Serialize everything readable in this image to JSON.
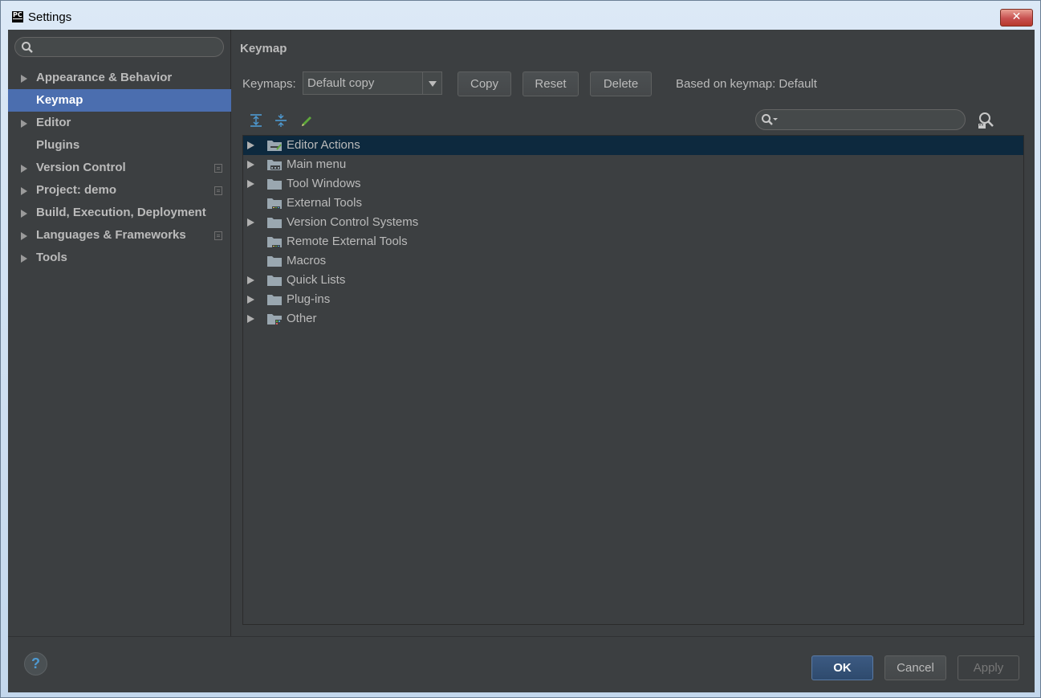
{
  "window": {
    "title": "Settings",
    "close_glyph": "✕"
  },
  "sidebar": {
    "search_placeholder": "",
    "items": [
      {
        "label": "Appearance & Behavior",
        "expandable": true
      },
      {
        "label": "Keymap",
        "expandable": false,
        "selected": true
      },
      {
        "label": "Editor",
        "expandable": true
      },
      {
        "label": "Plugins",
        "expandable": false
      },
      {
        "label": "Version Control",
        "expandable": true,
        "project_icon": true
      },
      {
        "label": "Project: demo",
        "expandable": true,
        "project_icon": true
      },
      {
        "label": "Build, Execution, Deployment",
        "expandable": true
      },
      {
        "label": "Languages & Frameworks",
        "expandable": true,
        "project_icon": true
      },
      {
        "label": "Tools",
        "expandable": true
      }
    ]
  },
  "main": {
    "title": "Keymap",
    "keymaps_label": "Keymaps:",
    "keymap_selected": "Default copy",
    "buttons": {
      "copy": "Copy",
      "reset": "Reset",
      "delete": "Delete"
    },
    "based_on": "Based on keymap: Default",
    "tree_search_placeholder": "",
    "tree": [
      {
        "label": "Editor Actions",
        "expandable": true,
        "selected": true,
        "icon": "editor-actions-folder-icon"
      },
      {
        "label": "Main menu",
        "expandable": true,
        "icon": "menu-folder-icon"
      },
      {
        "label": "Tool Windows",
        "expandable": true,
        "icon": "folder-icon"
      },
      {
        "label": "External Tools",
        "expandable": false,
        "icon": "tools-folder-icon"
      },
      {
        "label": "Version Control Systems",
        "expandable": true,
        "icon": "folder-icon"
      },
      {
        "label": "Remote External Tools",
        "expandable": false,
        "icon": "tools-folder-icon"
      },
      {
        "label": "Macros",
        "expandable": false,
        "icon": "folder-icon"
      },
      {
        "label": "Quick Lists",
        "expandable": true,
        "icon": "folder-icon"
      },
      {
        "label": "Plug-ins",
        "expandable": true,
        "icon": "folder-icon"
      },
      {
        "label": "Other",
        "expandable": true,
        "icon": "other-folder-icon"
      }
    ]
  },
  "footer": {
    "help": "?",
    "ok": "OK",
    "cancel": "Cancel",
    "apply": "Apply"
  },
  "colors": {
    "background": "#3c3f41",
    "selection": "#4b6eaf",
    "tree_selection": "#0d293e",
    "text": "#bbbbbb"
  }
}
